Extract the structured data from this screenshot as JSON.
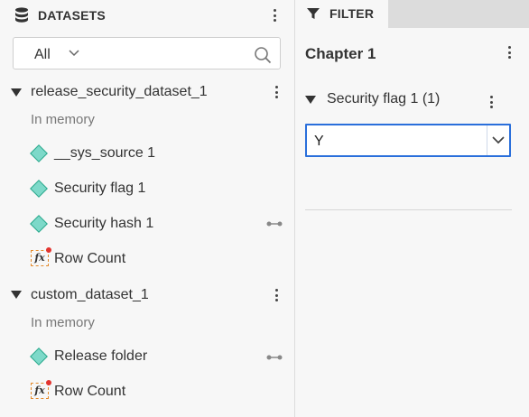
{
  "datasets_panel": {
    "title": "DATASETS",
    "filter": {
      "selected": "All"
    },
    "datasets": [
      {
        "name": "release_security_dataset_1",
        "status": "In memory",
        "expanded": true,
        "fields": [
          {
            "label": "__sys_source 1",
            "type": "dimension"
          },
          {
            "label": "Security flag 1",
            "type": "dimension"
          },
          {
            "label": "Security hash 1",
            "type": "dimension",
            "linked": true
          },
          {
            "label": "Row Count",
            "type": "calculated"
          }
        ]
      },
      {
        "name": "custom_dataset_1",
        "status": "In memory",
        "expanded": true,
        "fields": [
          {
            "label": "Release folder",
            "type": "dimension",
            "linked": true
          },
          {
            "label": "Row Count",
            "type": "calculated"
          }
        ]
      }
    ]
  },
  "filter_panel": {
    "tab_label": "FILTER",
    "chapter_title": "Chapter 1",
    "filter": {
      "name": "Security flag 1 (1)",
      "selected_value": "Y"
    }
  },
  "colors": {
    "accent": "#2a6fdb",
    "dimension_icon": "#7dd9c9",
    "calc_dot": "#e3342f"
  }
}
